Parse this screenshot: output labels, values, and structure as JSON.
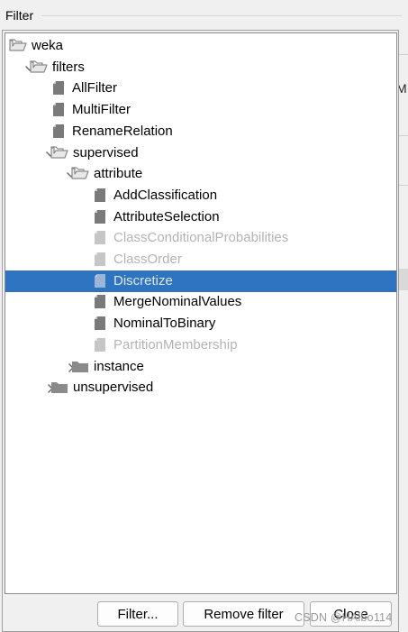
{
  "panel": {
    "title": "Filter",
    "background_fragment": "M"
  },
  "tree": {
    "nodes": [
      {
        "label": "weka",
        "type": "folder-open",
        "expander": "none",
        "depth": 0,
        "state": "normal"
      },
      {
        "label": "filters",
        "type": "folder-open",
        "expander": "expanded",
        "depth": 1,
        "state": "normal"
      },
      {
        "label": "AllFilter",
        "type": "file",
        "expander": "none",
        "depth": 2,
        "state": "normal"
      },
      {
        "label": "MultiFilter",
        "type": "file",
        "expander": "none",
        "depth": 2,
        "state": "normal"
      },
      {
        "label": "RenameRelation",
        "type": "file",
        "expander": "none",
        "depth": 2,
        "state": "normal"
      },
      {
        "label": "supervised",
        "type": "folder-open",
        "expander": "expanded",
        "depth": 2,
        "state": "normal"
      },
      {
        "label": "attribute",
        "type": "folder-open",
        "expander": "expanded",
        "depth": 3,
        "state": "normal"
      },
      {
        "label": "AddClassification",
        "type": "file",
        "expander": "none",
        "depth": 4,
        "state": "normal"
      },
      {
        "label": "AttributeSelection",
        "type": "file",
        "expander": "none",
        "depth": 4,
        "state": "normal"
      },
      {
        "label": "ClassConditionalProbabilities",
        "type": "file",
        "expander": "none",
        "depth": 4,
        "state": "disabled"
      },
      {
        "label": "ClassOrder",
        "type": "file",
        "expander": "none",
        "depth": 4,
        "state": "disabled"
      },
      {
        "label": "Discretize",
        "type": "file",
        "expander": "none",
        "depth": 4,
        "state": "selected"
      },
      {
        "label": "MergeNominalValues",
        "type": "file",
        "expander": "none",
        "depth": 4,
        "state": "normal"
      },
      {
        "label": "NominalToBinary",
        "type": "file",
        "expander": "none",
        "depth": 4,
        "state": "normal"
      },
      {
        "label": "PartitionMembership",
        "type": "file",
        "expander": "none",
        "depth": 4,
        "state": "disabled"
      },
      {
        "label": "instance",
        "type": "folder-closed",
        "expander": "collapsed",
        "depth": 3,
        "state": "normal"
      },
      {
        "label": "unsupervised",
        "type": "folder-closed",
        "expander": "collapsed",
        "depth": 2,
        "state": "normal"
      }
    ]
  },
  "buttons": {
    "filter": "Filter...",
    "remove": "Remove filter",
    "close": "Close"
  },
  "watermark": "CSDN @HAlbo114",
  "colors": {
    "selection": "#2f74c0",
    "disabled_text": "#b4b4b4",
    "icon_gray": "#7a7a7a",
    "folder_gray": "#8a8a8a"
  }
}
